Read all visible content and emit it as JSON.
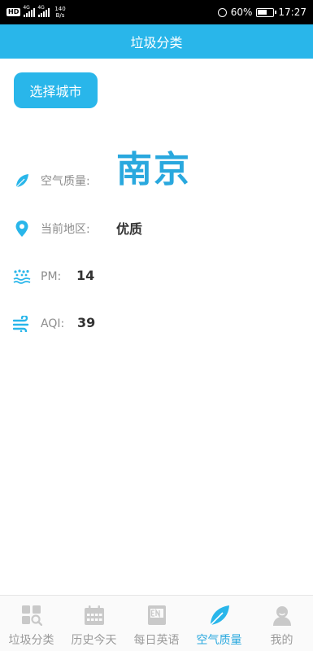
{
  "status_bar": {
    "network_hd": "HD",
    "signal_1": "4G",
    "signal_2": "4G",
    "speed_value": "140",
    "speed_unit": "B/s",
    "battery": "60%",
    "time": "17:27"
  },
  "header": {
    "title": "垃圾分类"
  },
  "city_button": {
    "label": "选择城市"
  },
  "city": {
    "name": "南京"
  },
  "info": {
    "air_quality": {
      "label": "空气质量:",
      "value": ""
    },
    "region": {
      "label": "当前地区:",
      "value": "优质"
    },
    "pm": {
      "label": "PM:",
      "value": "14"
    },
    "aqi": {
      "label": "AQI:",
      "value": "39"
    }
  },
  "tabs": [
    {
      "label": "垃圾分类",
      "icon": "garbage-sort-icon"
    },
    {
      "label": "历史今天",
      "icon": "calendar-icon"
    },
    {
      "label": "每日英语",
      "icon": "english-book-icon"
    },
    {
      "label": "空气质量",
      "icon": "leaf-icon",
      "active": true
    },
    {
      "label": "我的",
      "icon": "user-icon"
    }
  ],
  "colors": {
    "accent": "#29b6ea",
    "city": "#29a8de",
    "muted": "#8d8d8d",
    "tab_inactive": "#9b9b9b"
  }
}
